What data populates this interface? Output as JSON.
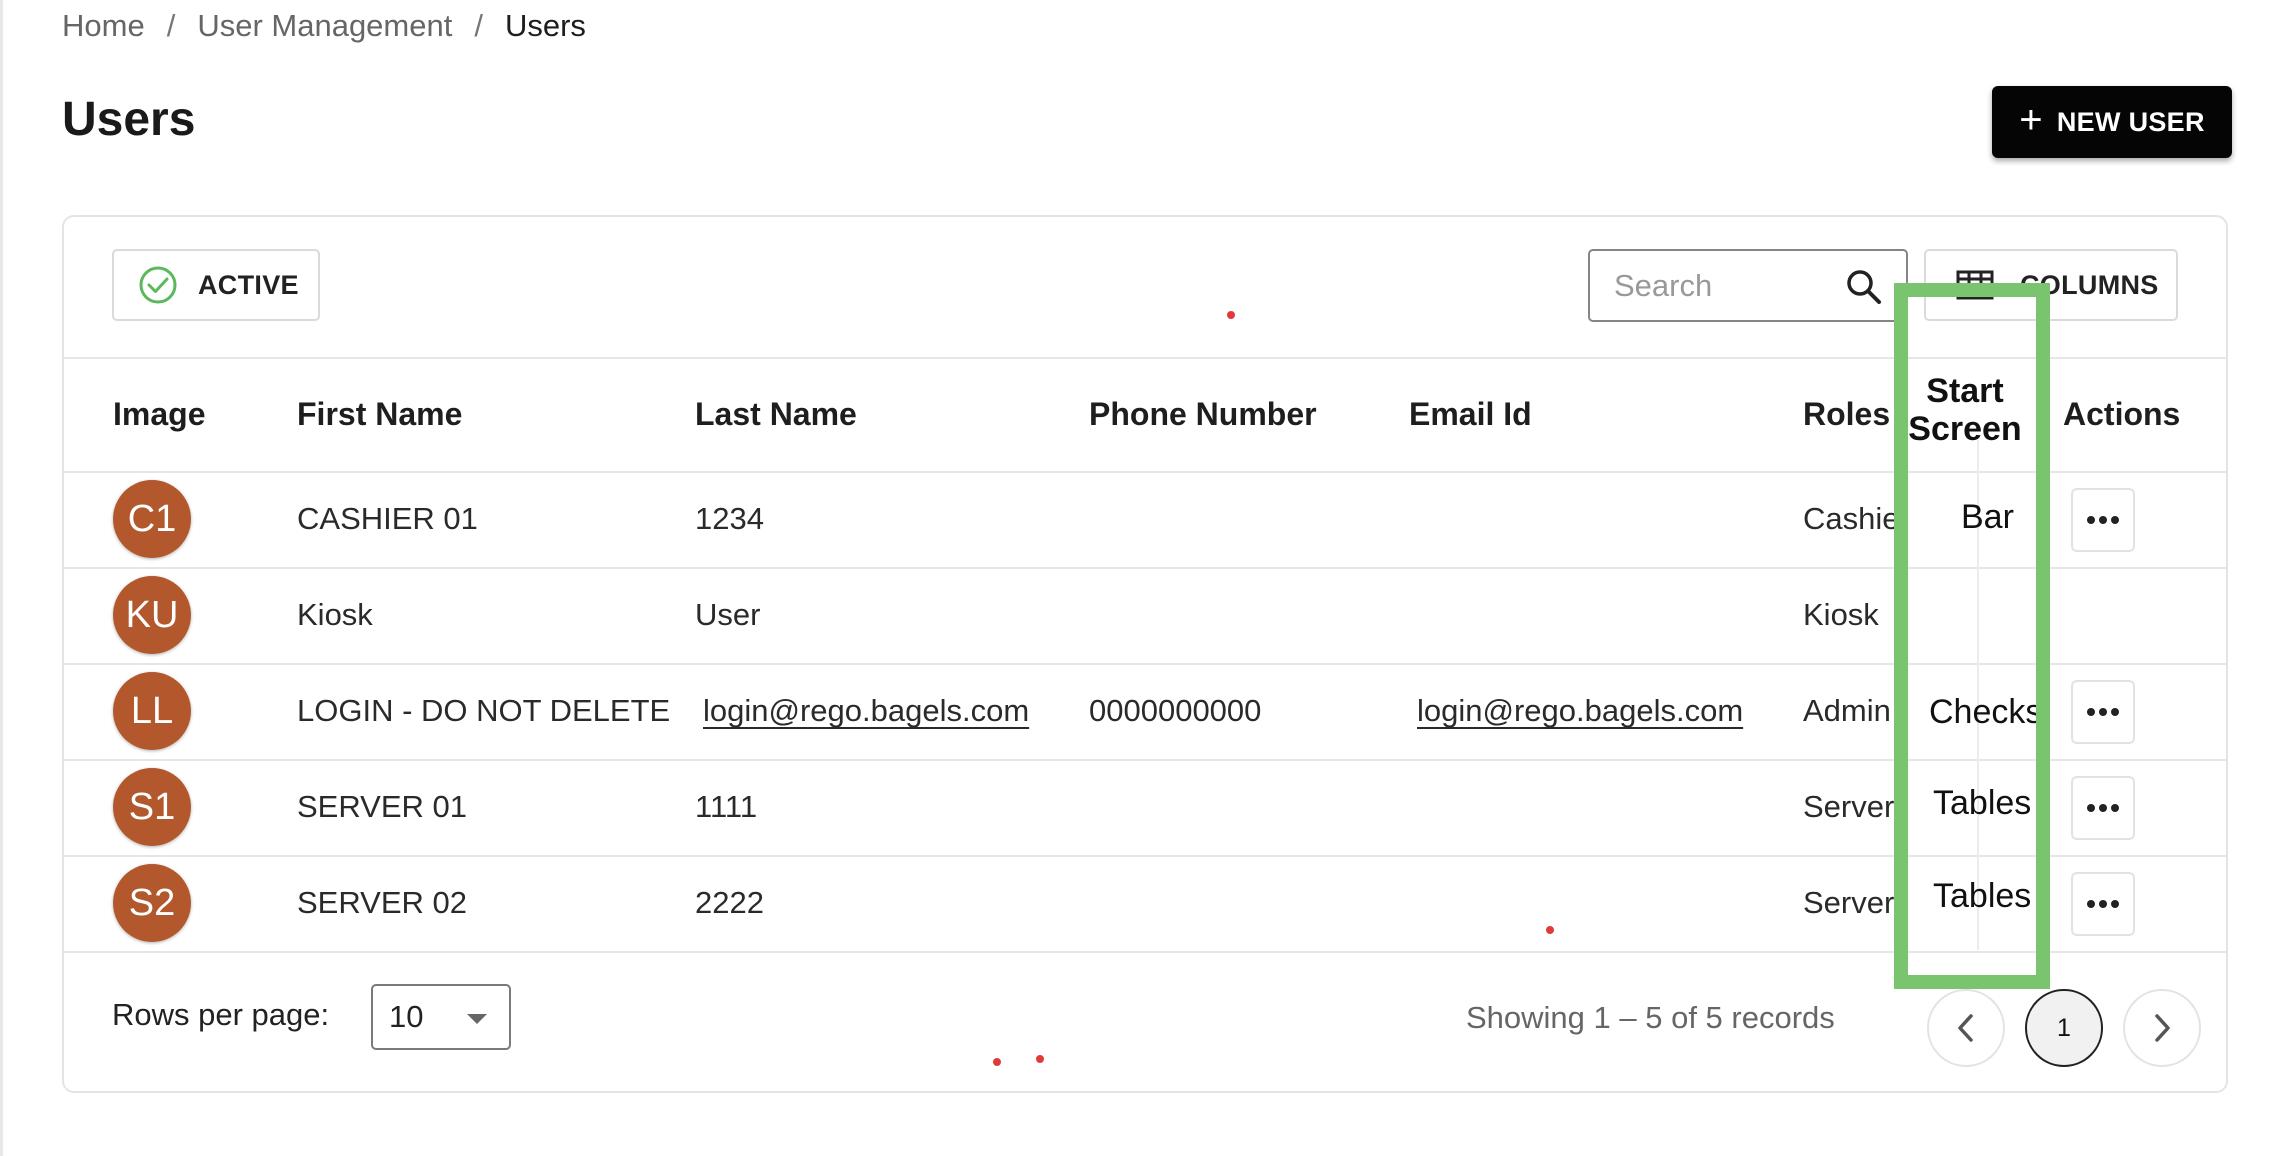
{
  "breadcrumb": {
    "items": [
      "Home",
      "User Management"
    ],
    "separator": "/",
    "current": "Users"
  },
  "page": {
    "title": "Users"
  },
  "toolbar": {
    "new_user_label": "NEW USER",
    "filter_label": "ACTIVE",
    "search_placeholder": "Search",
    "columns_label": "COLUMNS"
  },
  "table": {
    "headers": {
      "image": "Image",
      "first_name": "First Name",
      "last_name": "Last Name",
      "phone": "Phone Number",
      "email": "Email Id",
      "roles": "Roles",
      "start_screen_line1": "Start",
      "start_screen_line2": "Screen",
      "actions": "Actions"
    },
    "rows": [
      {
        "initials": "C1",
        "first_name": "CASHIER 01",
        "last_name": "1234",
        "phone": "",
        "email": "",
        "role": "Cashie",
        "start_screen": "Bar"
      },
      {
        "initials": "KU",
        "first_name": "Kiosk",
        "last_name": "User",
        "phone": "",
        "email": "",
        "role": "Kiosk",
        "start_screen": ""
      },
      {
        "initials": "LL",
        "first_name": "LOGIN - DO NOT DELETE",
        "last_name": "login@rego.bagels.com",
        "phone": "0000000000",
        "email": "login@rego.bagels.com",
        "role": "Admin",
        "start_screen": "Checks"
      },
      {
        "initials": "S1",
        "first_name": "SERVER 01",
        "last_name": "1111",
        "phone": "",
        "email": "",
        "role": "Server",
        "start_screen": "Tables"
      },
      {
        "initials": "S2",
        "first_name": "SERVER 02",
        "last_name": "2222",
        "phone": "",
        "email": "",
        "role": "Server",
        "start_screen": "Tables"
      }
    ]
  },
  "footer": {
    "rows_per_page_label": "Rows per page:",
    "rows_per_page_value": "10",
    "records_text": "Showing 1 – 5 of 5 records",
    "current_page": "1"
  },
  "colors": {
    "avatar_bg": "#b3582d",
    "highlight": "#7ac46f",
    "check_icon": "#5cb85c",
    "primary_button": "#050505"
  }
}
